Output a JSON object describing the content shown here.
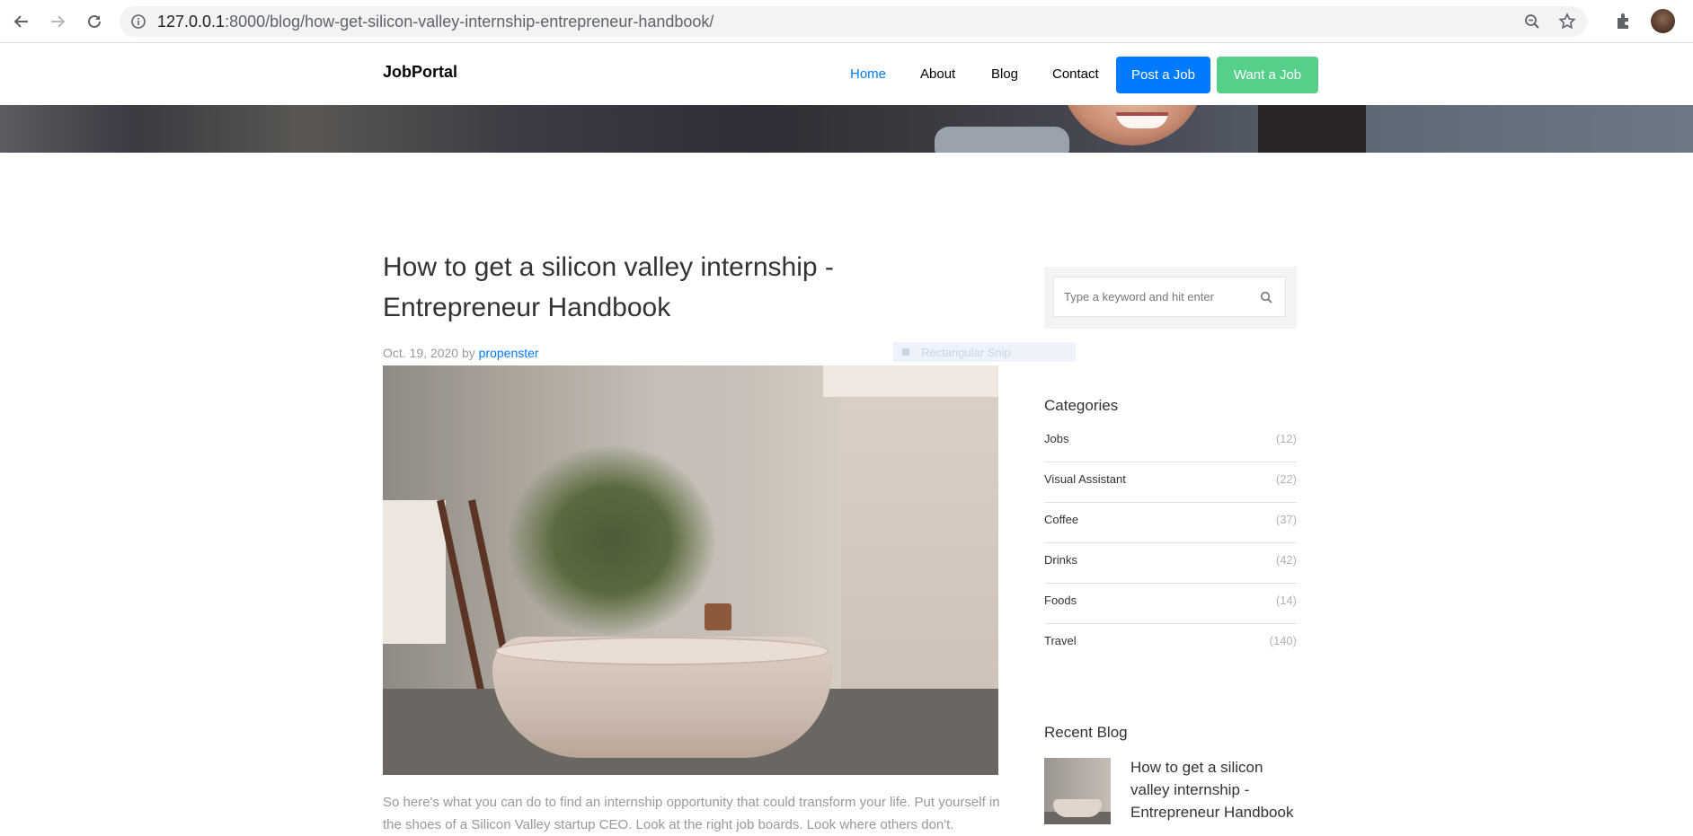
{
  "browser": {
    "url_host": "127.0.0.1",
    "url_rest": ":8000/blog/how-get-silicon-valley-internship-entrepreneur-handbook/"
  },
  "nav": {
    "brand": "JobPortal",
    "items": [
      {
        "label": "Home",
        "active": true
      },
      {
        "label": "About"
      },
      {
        "label": "Blog"
      },
      {
        "label": "Contact"
      }
    ],
    "post_job": "Post a Job",
    "want_job": "Want a Job"
  },
  "article": {
    "title": "How to get a silicon valley internship - Entrepreneur Handbook",
    "date": "Oct. 19, 2020",
    "by": "by",
    "author": "propenster",
    "excerpt": "So here's what you can do to find an internship opportunity that could transform your life. Put yourself in the shoes of a Silicon Valley startup CEO. Look at the right job boards. Look where others don't."
  },
  "overlay": {
    "snip_label": "Rectangular Snip"
  },
  "sidebar": {
    "search_placeholder": "Type a keyword and hit enter",
    "categories_title": "Categories",
    "categories": [
      {
        "name": "Jobs",
        "count": "(12)"
      },
      {
        "name": "Visual Assistant",
        "count": "(22)"
      },
      {
        "name": "Coffee",
        "count": "(37)"
      },
      {
        "name": "Drinks",
        "count": "(42)"
      },
      {
        "name": "Foods",
        "count": "(14)"
      },
      {
        "name": "Travel",
        "count": "(140)"
      }
    ],
    "recent_title": "Recent Blog",
    "recent_post": "How to get a silicon valley internship - Entrepreneur Handbook"
  },
  "colors": {
    "primary": "#007bff",
    "success": "#54d08b",
    "muted": "#999999"
  }
}
